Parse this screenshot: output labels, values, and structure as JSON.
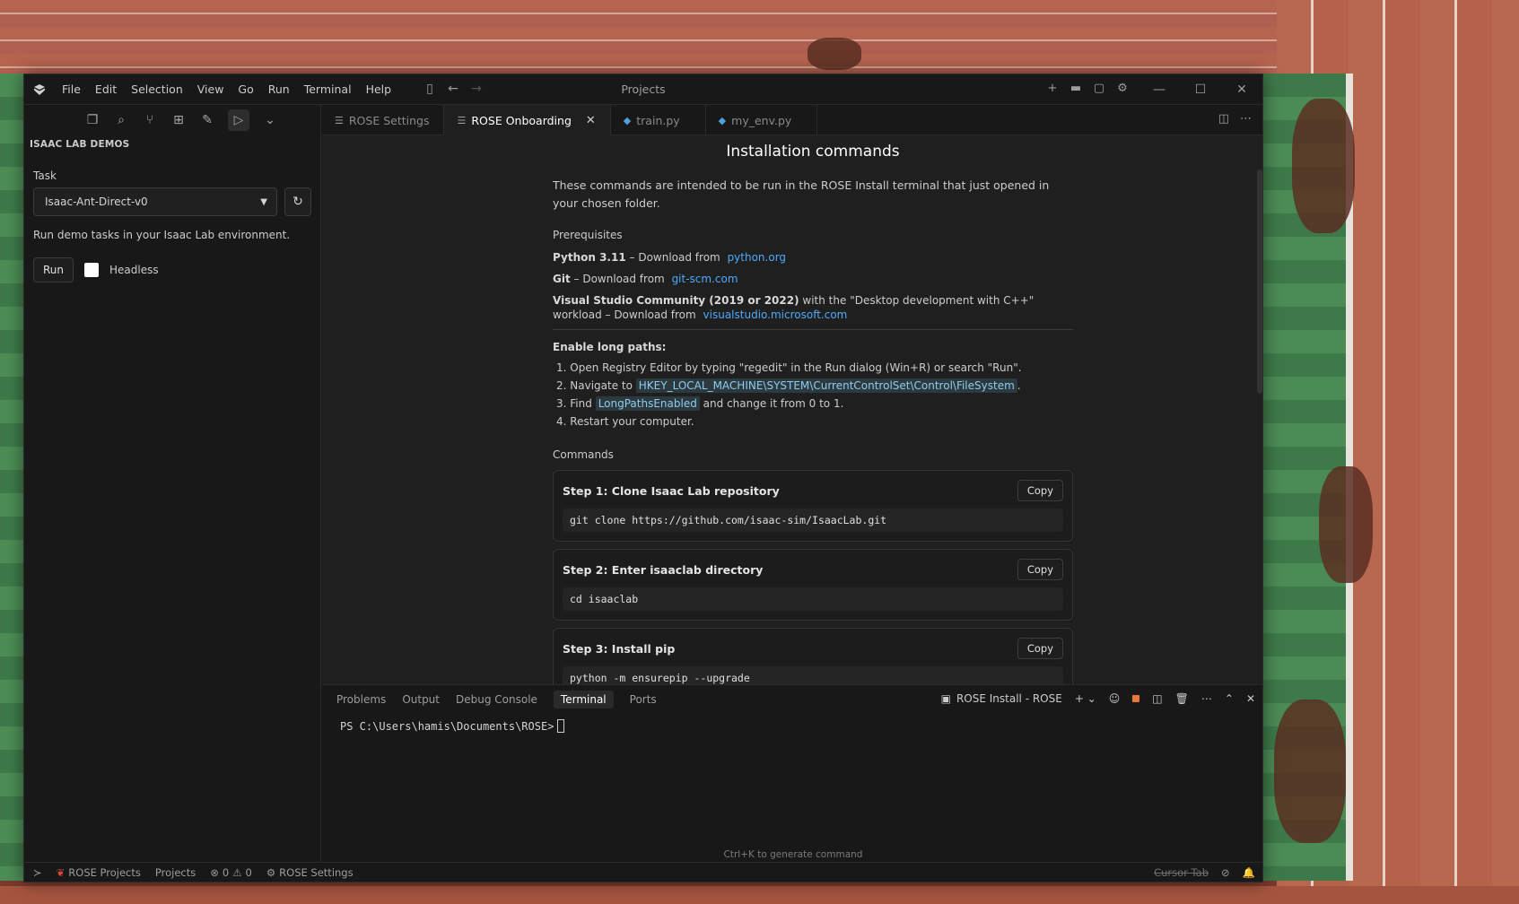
{
  "titlebar": {
    "menu": [
      "File",
      "Edit",
      "Selection",
      "View",
      "Go",
      "Run",
      "Terminal",
      "Help"
    ],
    "window_title": "Projects"
  },
  "sidebar": {
    "header": "ISAAC LAB DEMOS",
    "task_label": "Task",
    "task_value": "Isaac-Ant-Direct-v0",
    "description": "Run demo tasks in your Isaac Lab environment.",
    "run_label": "Run",
    "headless_label": "Headless"
  },
  "tabs": [
    {
      "label": "ROSE Settings",
      "icon": "preview-icon",
      "active": false
    },
    {
      "label": "ROSE Onboarding",
      "icon": "preview-icon",
      "active": true
    },
    {
      "label": "train.py",
      "icon": "python-icon",
      "active": false
    },
    {
      "label": "my_env.py",
      "icon": "python-icon",
      "active": false
    }
  ],
  "doc": {
    "title": "Installation commands",
    "intro": "These commands are intended to be run in the ROSE Install terminal that just opened in your chosen folder.",
    "prereq_heading": "Prerequisites",
    "python": {
      "name": "Python 3.11",
      "text": " – Download from",
      "link": "python.org"
    },
    "git": {
      "name": "Git",
      "text": " – Download from",
      "link": "git-scm.com"
    },
    "vs": {
      "name": "Visual Studio Community (2019 or 2022)",
      "text": " with the \"Desktop development with C++\" workload – Download from",
      "link": "visualstudio.microsoft.com"
    },
    "long_paths": {
      "heading": "Enable long paths:",
      "step1": "1. Open Registry Editor by typing \"regedit\" in the Run dialog (Win+R) or search \"Run\".",
      "step2_pre": "2. Navigate to",
      "step2_code": "HKEY_LOCAL_MACHINE\\SYSTEM\\CurrentControlSet\\Control\\FileSystem",
      "step2_post": ".",
      "step3_pre": "3. Find",
      "step3_code": "LongPathsEnabled",
      "step3_post": "and change it from 0 to 1.",
      "step4": "4. Restart your computer."
    },
    "commands_heading": "Commands",
    "commands": [
      {
        "title": "Step 1: Clone Isaac Lab repository",
        "code": "git clone https://github.com/isaac-sim/IsaacLab.git",
        "copy": "Copy"
      },
      {
        "title": "Step 2: Enter isaaclab directory",
        "code": "cd isaaclab",
        "copy": "Copy"
      },
      {
        "title": "Step 3: Install pip",
        "code": "python -m ensurepip --upgrade",
        "copy": "Copy"
      }
    ]
  },
  "panel": {
    "tabs": [
      "Problems",
      "Output",
      "Debug Console",
      "Terminal",
      "Ports"
    ],
    "active_tab": "Terminal",
    "terminal_name": "ROSE Install - ROSE",
    "prompt": "PS C:\\Users\\hamis\\Documents\\ROSE>",
    "hint": "Ctrl+K to generate command"
  },
  "statusbar": {
    "rose_projects": "ROSE Projects",
    "projects": "Projects",
    "errors": "0",
    "warnings": "0",
    "rose_settings": "ROSE Settings",
    "cursor_tab": "Cursor Tab"
  },
  "colors": {
    "link": "#4daafc",
    "stop_button": "#e8793b",
    "accent": "#ffffff"
  }
}
